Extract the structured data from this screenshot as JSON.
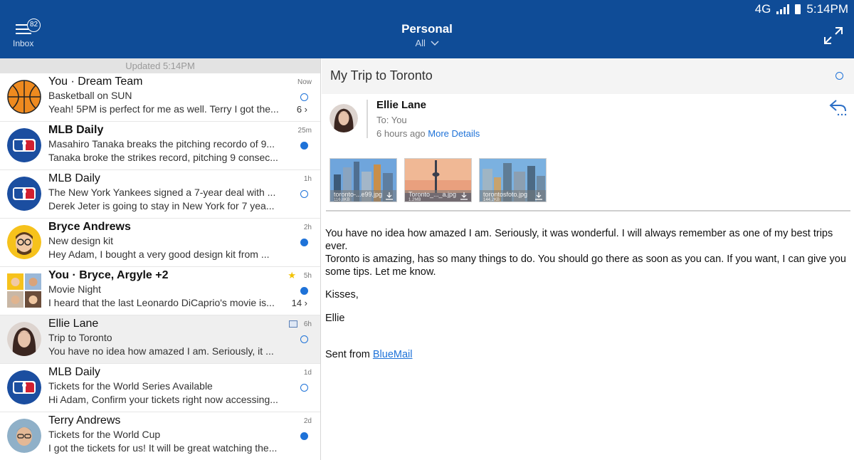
{
  "statusbar": {
    "network": "4G",
    "time": "5:14PM"
  },
  "header": {
    "badge_count": "82",
    "inbox_label": "Inbox",
    "title": "Personal",
    "filter": "All"
  },
  "list": {
    "updated_text": "Updated 5:14PM",
    "items": [
      {
        "sender": "You · Dream Team",
        "subject": "Basketball on SUN",
        "preview": "Yeah! 5PM is perfect for me as well. Terry I got the...",
        "time": "Now",
        "status": "read",
        "count": "6 ›",
        "avatar": "basketball-icon",
        "unread": false
      },
      {
        "sender": "MLB Daily",
        "subject": "Masahiro Tanaka breaks the pitching recordo of 9...",
        "preview": "Tanaka broke the strikes record, pitching 9 consec...",
        "time": "25m",
        "status": "unread",
        "count": "",
        "avatar": "mlb-logo",
        "unread": true
      },
      {
        "sender": "MLB Daily",
        "subject": "The New York Yankees signed a 7-year deal with ...",
        "preview": "Derek Jeter is going to stay in New York for 7 yea...",
        "time": "1h",
        "status": "read",
        "count": "",
        "avatar": "mlb-logo",
        "unread": false
      },
      {
        "sender": "Bryce Andrews",
        "subject": "New design kit",
        "preview": "Hey Adam, I bought a very good design kit from ...",
        "time": "2h",
        "status": "unread",
        "count": "",
        "avatar": "person-glasses",
        "unread": true
      },
      {
        "sender": "You · Bryce, Argyle +2",
        "subject": "Movie Night",
        "preview": "I heard that the last Leonardo DiCaprio's movie is...",
        "time": "5h",
        "status": "unread",
        "count": "14 ›",
        "avatar": "group-photos",
        "unread": true,
        "starred": true
      },
      {
        "sender": "Ellie Lane",
        "subject": "Trip to Toronto",
        "preview": "You have no idea how amazed I am. Seriously, it ...",
        "time": "6h",
        "status": "read",
        "count": "",
        "avatar": "woman-photo",
        "unread": false,
        "has_image": true,
        "selected": true
      },
      {
        "sender": "MLB Daily",
        "subject": "Tickets for the World Series Available",
        "preview": "Hi Adam, Confirm your tickets right now accessing...",
        "time": "1d",
        "status": "read",
        "count": "",
        "avatar": "mlb-logo",
        "unread": false
      },
      {
        "sender": "Terry Andrews",
        "subject": "Tickets for the World Cup",
        "preview": "I got the tickets for us! It will be great watching the...",
        "time": "2d",
        "status": "unread",
        "count": "",
        "avatar": "man-photo",
        "unread": false
      }
    ]
  },
  "message": {
    "subject": "My Trip to Toronto",
    "from": "Ellie Lane",
    "to": "To: You",
    "time": "6 hours ago",
    "more_details": "More Details",
    "attachments": [
      {
        "name": "toronto-...e99.jpg",
        "size": "116.8KB"
      },
      {
        "name": "Toronto_..._a.jpg",
        "size": "1.2MB"
      },
      {
        "name": "torontosfoto.jpg",
        "size": "144.2KB"
      }
    ],
    "body_p1": "You have no idea how amazed I am. Seriously, it was wonderful. I will always remember as one of my best trips ever.",
    "body_p2": "Toronto is amazing, has so many things to do. You should go there as soon as you can. If you want, I can give you some tips. Let me know.",
    "body_p3": "Kisses,",
    "body_p4": "Ellie",
    "sent_prefix": "Sent from",
    "sent_link": "BlueMail"
  },
  "colors": {
    "header": "#0f4c97",
    "accent": "#1e72d8",
    "star": "#f2c200"
  }
}
